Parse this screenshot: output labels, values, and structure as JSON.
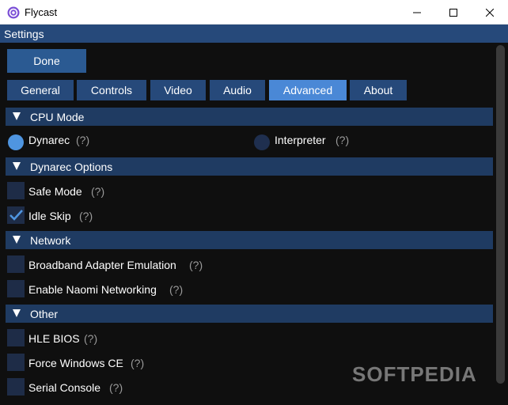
{
  "window": {
    "title": "Flycast",
    "icons": {
      "app": "flycast-logo-icon",
      "minimize": "minimize-icon",
      "maximize": "maximize-icon",
      "close": "close-icon"
    }
  },
  "header": {
    "title": "Settings"
  },
  "done_button": {
    "label": "Done"
  },
  "tabs": [
    {
      "label": "General",
      "active": false
    },
    {
      "label": "Controls",
      "active": false
    },
    {
      "label": "Video",
      "active": false
    },
    {
      "label": "Audio",
      "active": false
    },
    {
      "label": "Advanced",
      "active": true
    },
    {
      "label": "About",
      "active": false
    }
  ],
  "help_marker": "(?)",
  "sections": {
    "cpu_mode": {
      "title": "CPU Mode",
      "options": [
        {
          "label": "Dynarec",
          "selected": true
        },
        {
          "label": "Interpreter",
          "selected": false
        }
      ]
    },
    "dynarec_options": {
      "title": "Dynarec Options",
      "items": [
        {
          "label": "Safe Mode",
          "checked": false
        },
        {
          "label": "Idle Skip",
          "checked": true
        }
      ]
    },
    "network": {
      "title": "Network",
      "items": [
        {
          "label": "Broadband Adapter Emulation",
          "checked": false
        },
        {
          "label": "Enable Naomi Networking",
          "checked": false
        }
      ]
    },
    "other": {
      "title": "Other",
      "items": [
        {
          "label": "HLE BIOS",
          "checked": false
        },
        {
          "label": "Force Windows CE",
          "checked": false
        },
        {
          "label": "Serial Console",
          "checked": false
        }
      ]
    }
  },
  "watermark": "SOFTPEDIA",
  "colors": {
    "background": "#0f0f0f",
    "header": "#26497a",
    "tab": "#26497a",
    "tab_active": "#4a88d6",
    "section": "#1f3b62",
    "checkbox": "#1e2c47",
    "accent": "#4f95e0"
  }
}
